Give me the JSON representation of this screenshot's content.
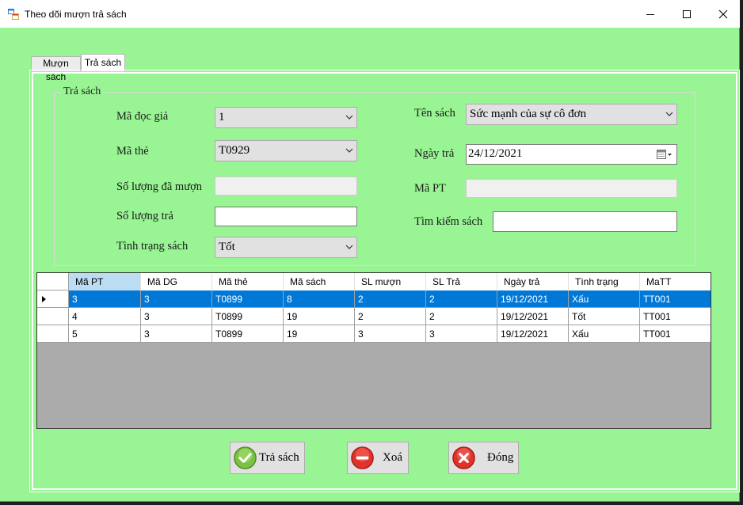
{
  "window": {
    "title": "Theo dõi mượn trả sách"
  },
  "tabs": [
    {
      "label": "Mượn sách"
    },
    {
      "label": "Trả sách"
    }
  ],
  "group": {
    "title": "Trả sách"
  },
  "form": {
    "ma_doc_gia": {
      "label": "Mã đọc giả",
      "value": "1"
    },
    "ma_the": {
      "label": "Mã thẻ",
      "value": "T0929"
    },
    "so_luong_da_muon": {
      "label": "Số lượng đã mượn",
      "value": ""
    },
    "so_luong_tra": {
      "label": "Số lượng trả",
      "value": ""
    },
    "tinh_trang_sach": {
      "label": "Tình trạng sách",
      "value": "Tốt"
    },
    "ten_sach": {
      "label": "Tên sách",
      "value": "Sức mạnh của sự cô đơn"
    },
    "ngay_tra": {
      "label": "Ngày trả",
      "value": "24/12/2021"
    },
    "ma_pt": {
      "label": "Mã PT",
      "value": ""
    },
    "tim_kiem_sach": {
      "label": "Tìm kiếm sách",
      "value": ""
    }
  },
  "grid": {
    "columns": [
      "Mã PT",
      "Mã DG",
      "Mã thẻ",
      "Mã sách",
      "SL mượn",
      "SL Trả",
      "Ngày trả",
      "Tình trạng",
      "MaTT"
    ],
    "rows": [
      [
        "3",
        "3",
        "T0899",
        "8",
        "2",
        "2",
        "19/12/2021",
        "Xấu",
        "TT001"
      ],
      [
        "4",
        "3",
        "T0899",
        "19",
        "2",
        "2",
        "19/12/2021",
        "Tốt",
        "TT001"
      ],
      [
        "5",
        "3",
        "T0899",
        "19",
        "3",
        "3",
        "19/12/2021",
        "Xấu",
        "TT001"
      ]
    ],
    "selected_row": 0
  },
  "buttons": {
    "tra_sach": "Trả sách",
    "xoa": "Xoá",
    "dong": "Đóng"
  },
  "colors": {
    "form_bg": "#99f493",
    "selection": "#0078d7",
    "grid_bg": "#ababab"
  }
}
